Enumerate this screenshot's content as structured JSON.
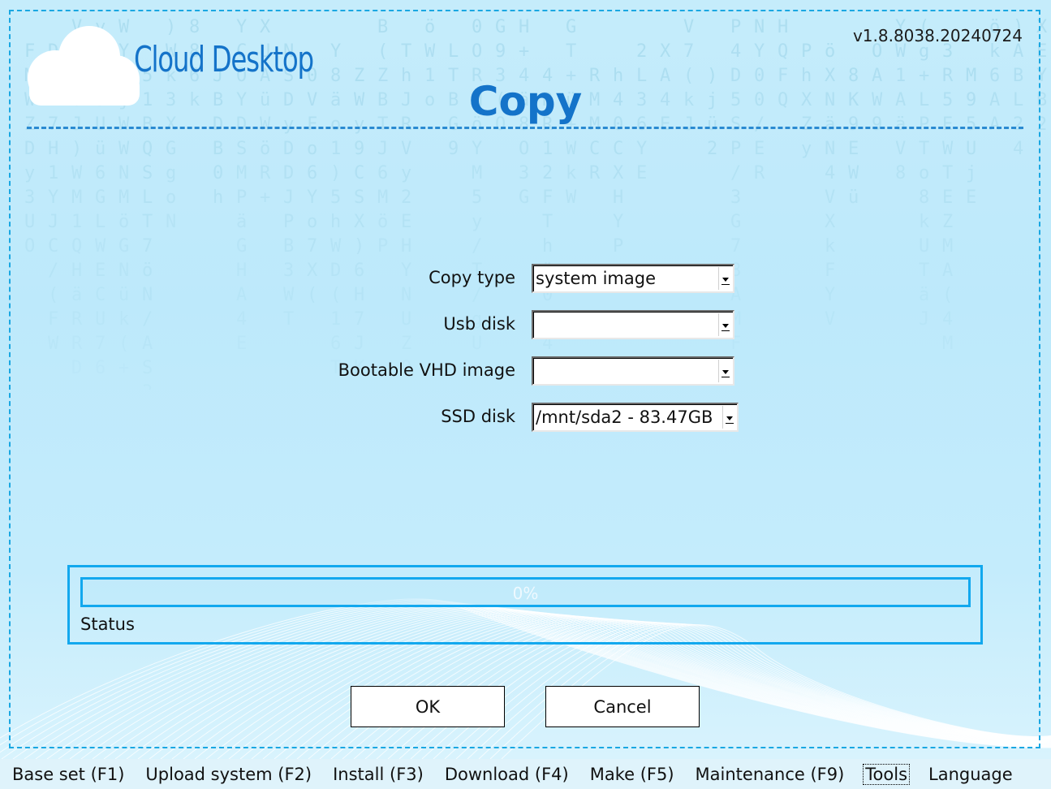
{
  "header": {
    "app_title": "Cloud Desktop",
    "version": "v1.8.8038.20240724",
    "page_title": "Copy",
    "logo_icon": "cloud-icon"
  },
  "form": {
    "fields": [
      {
        "label": "Copy type",
        "value": "system image"
      },
      {
        "label": "Usb disk",
        "value": ""
      },
      {
        "label": "Bootable VHD image",
        "value": ""
      },
      {
        "label": "SSD disk",
        "value": "/mnt/sda2 - 83.47GB"
      }
    ]
  },
  "progress": {
    "percent": 0,
    "text": "0%",
    "status": "Status"
  },
  "buttons": {
    "ok": "OK",
    "cancel": "Cancel"
  },
  "menu": {
    "items": [
      "Base set (F1)",
      "Upload system (F2)",
      "Install (F3)",
      "Download (F4)",
      "Make (F5)",
      "Maintenance (F9)",
      "Tools",
      "Language"
    ],
    "active": "Tools"
  },
  "colors": {
    "accent": "#1473c9",
    "frame": "#1aa7e2",
    "progress": "#12a8ee"
  }
}
